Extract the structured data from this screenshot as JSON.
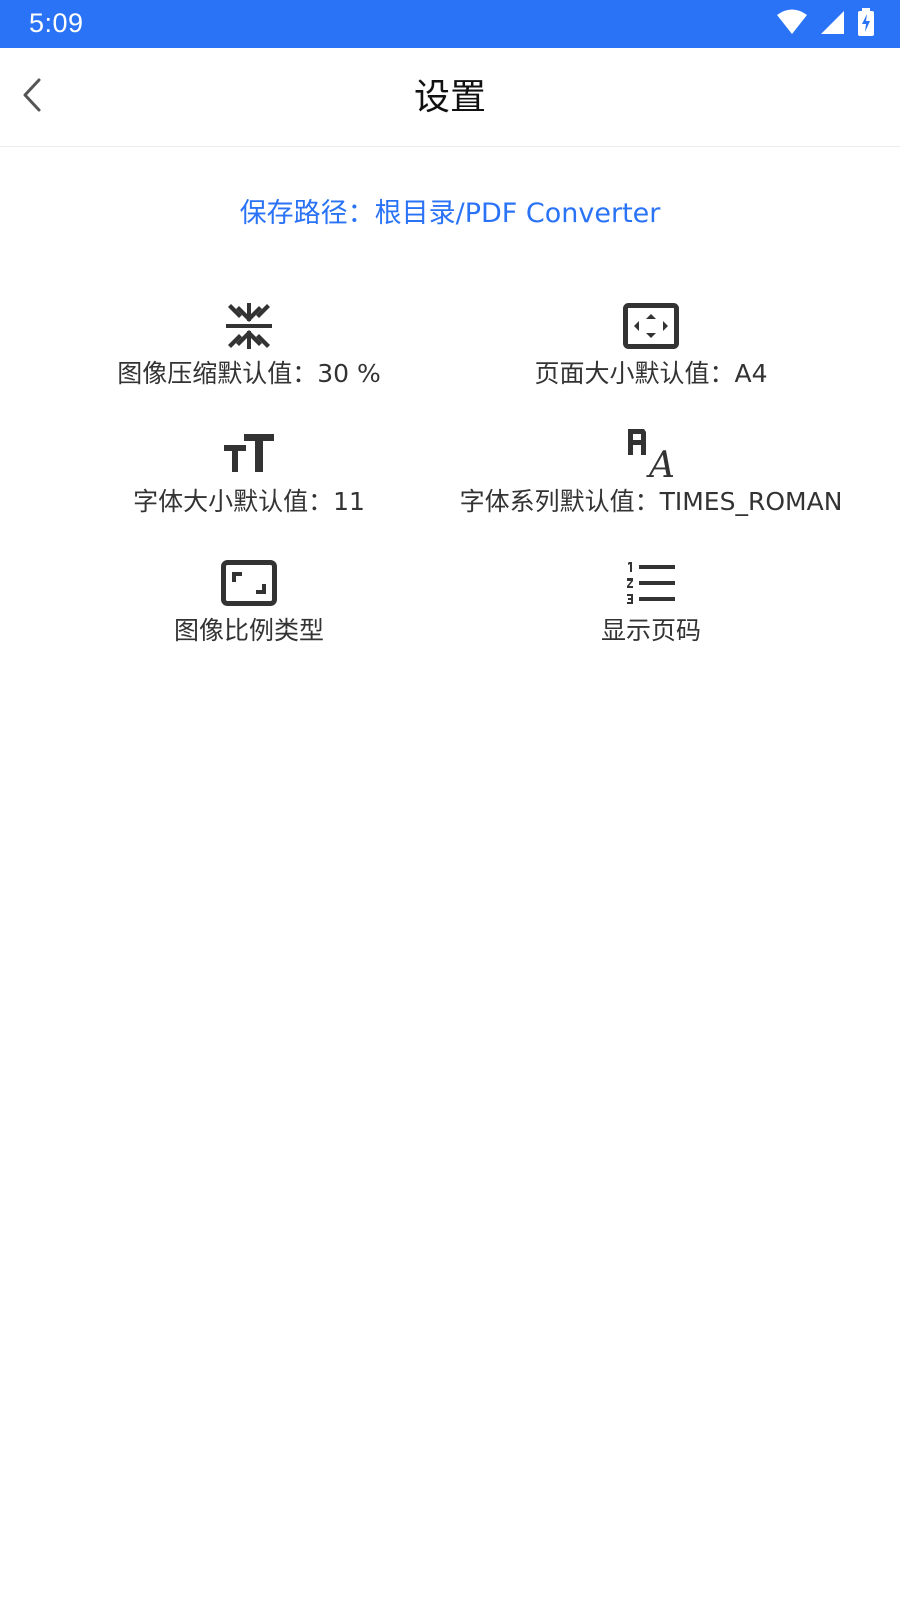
{
  "status_bar": {
    "time": "5:09",
    "icons": [
      "wifi-icon",
      "signal-icon",
      "battery-charging-icon"
    ],
    "background": "#2a73f6"
  },
  "appbar": {
    "title": "设置",
    "back_icon": "chevron-left-icon"
  },
  "save_path": {
    "text": "保存路径：根目录/PDF Converter",
    "color": "#2a73f6"
  },
  "settings": [
    {
      "icon": "compress-icon",
      "label": "图像压缩默认值：30 %"
    },
    {
      "icon": "page-size-icon",
      "label": "页面大小默认值：A4"
    },
    {
      "icon": "font-size-icon",
      "label": "字体大小默认值：11"
    },
    {
      "icon": "font-family-icon",
      "label": "字体系列默认值：TIMES_ROMAN"
    },
    {
      "icon": "aspect-ratio-icon",
      "label": "图像比例类型"
    },
    {
      "icon": "numbered-list-icon",
      "label": "显示页码"
    }
  ]
}
